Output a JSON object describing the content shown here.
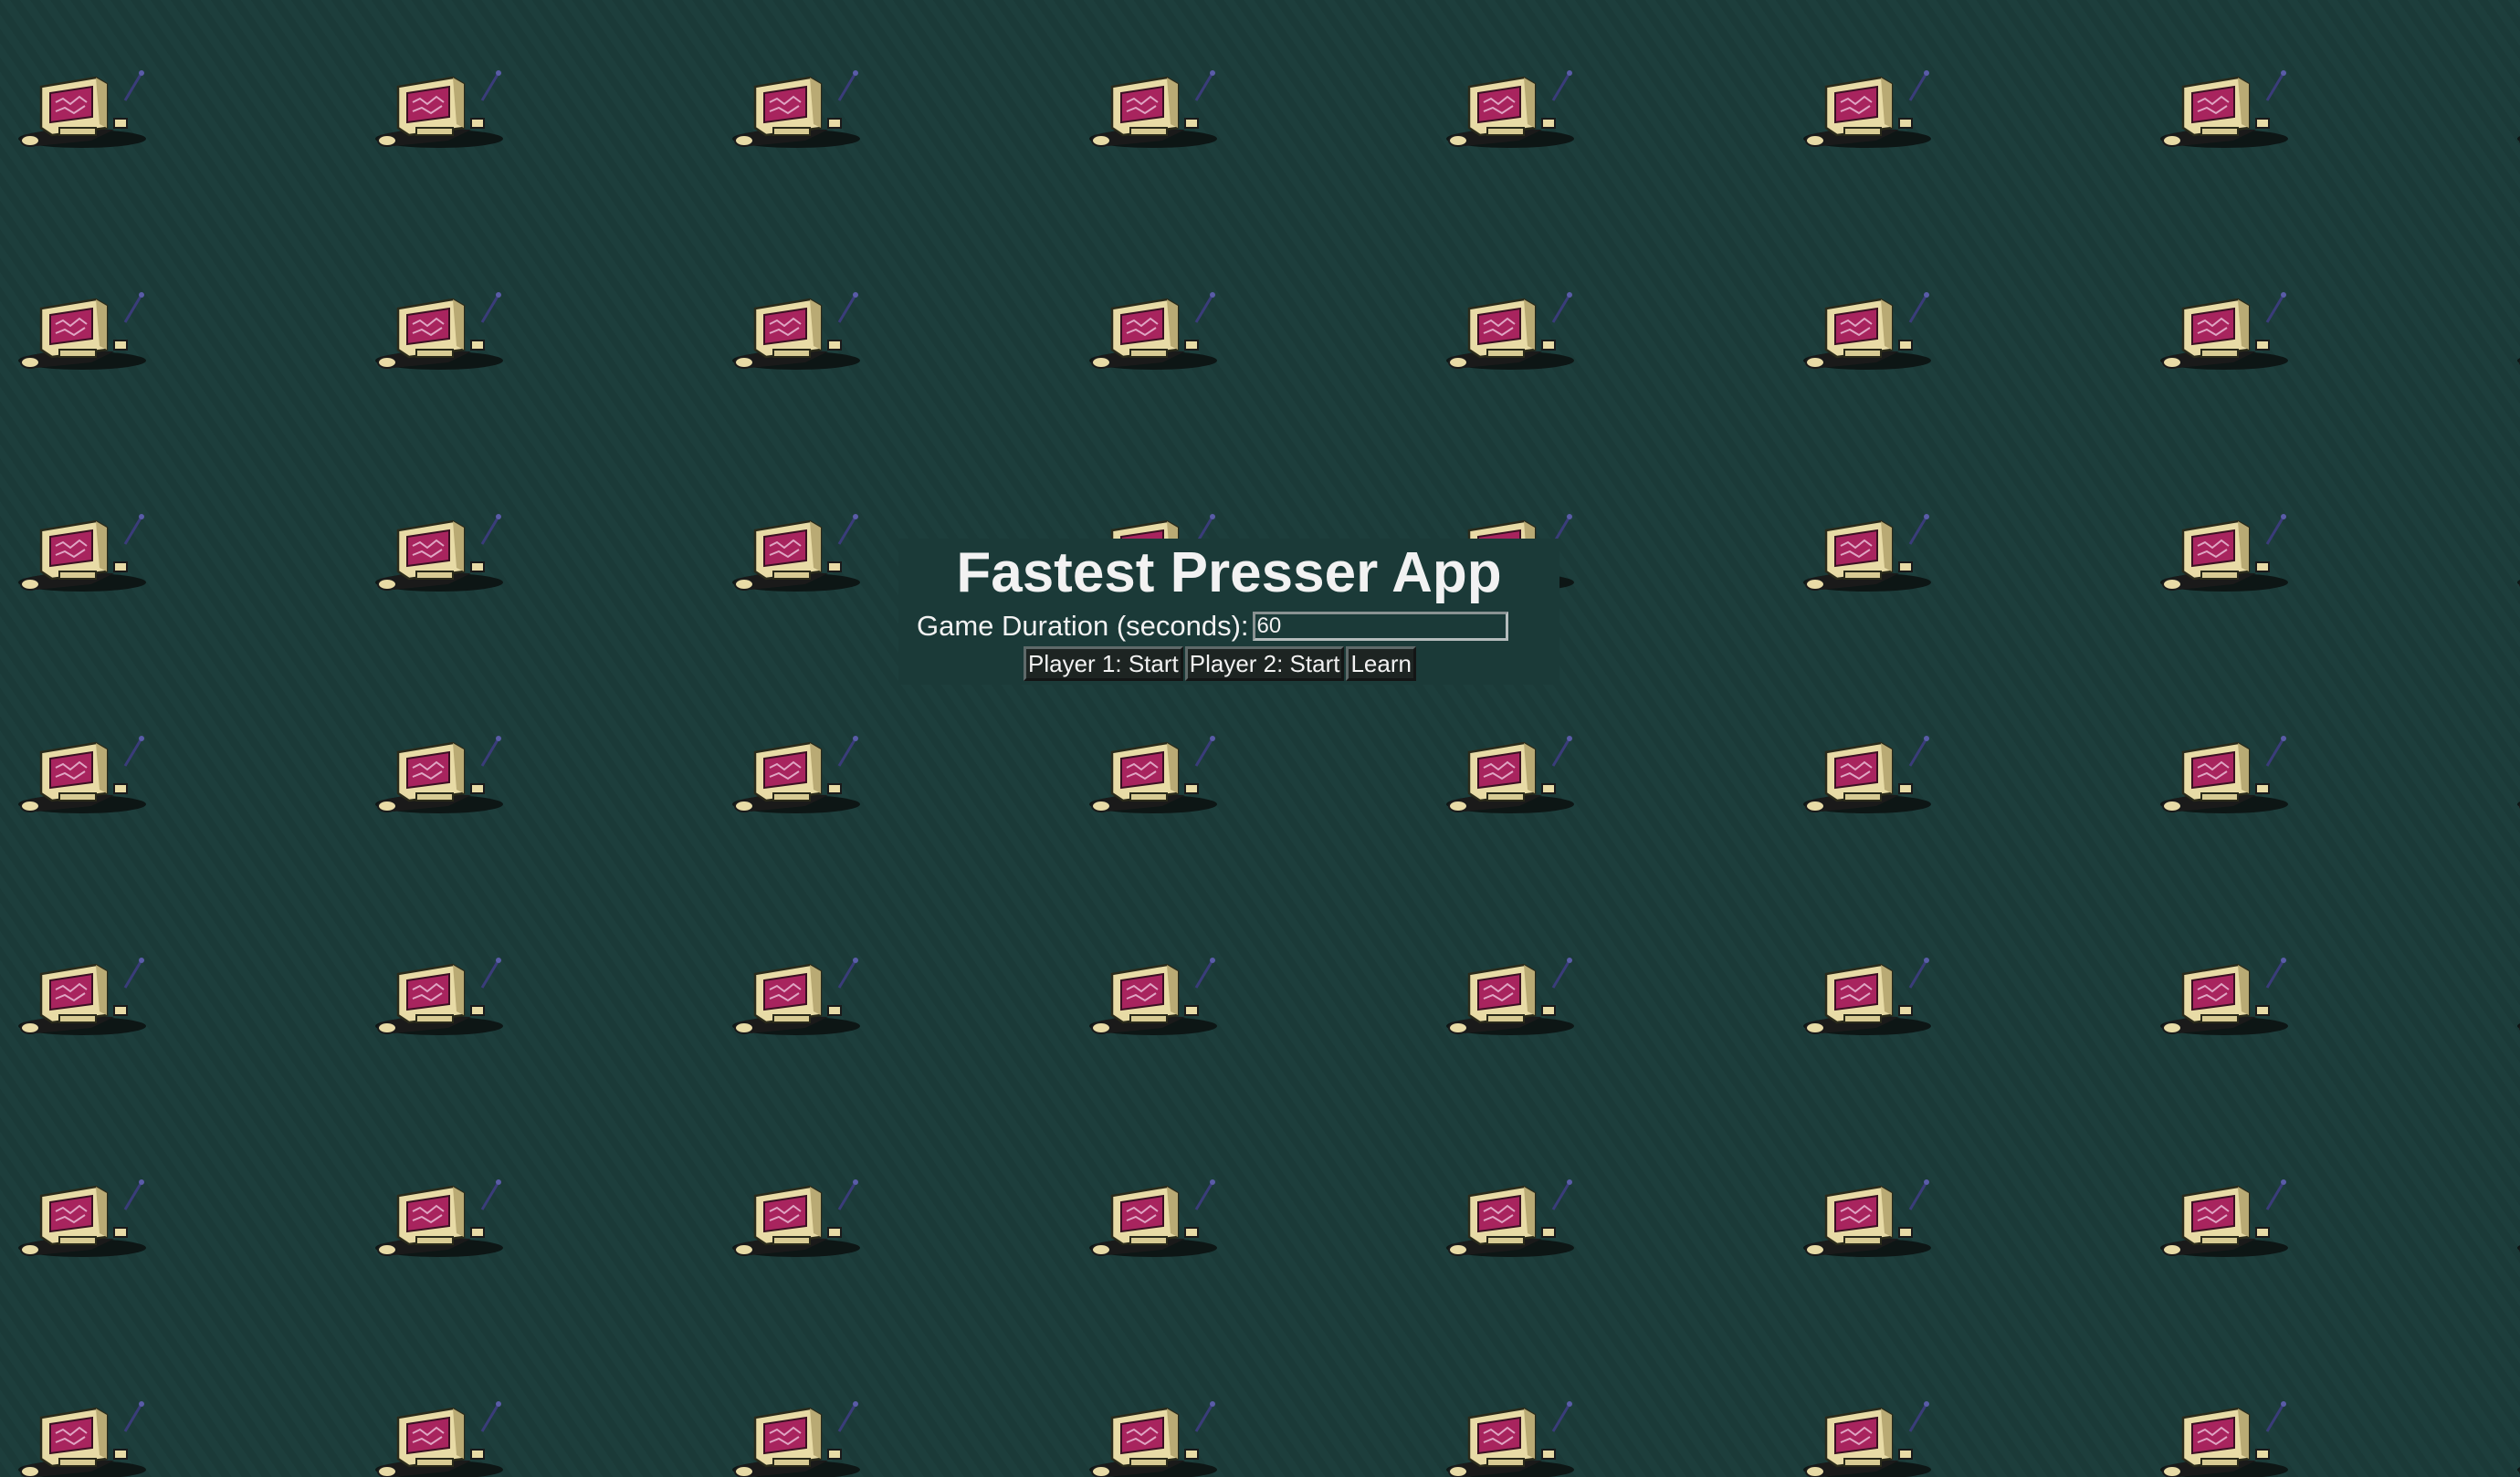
{
  "app": {
    "title": "Fastest Presser App"
  },
  "settings": {
    "duration_label": "Game Duration (seconds):",
    "duration_value": "60"
  },
  "buttons": {
    "player1": "Player 1: Start",
    "player2": "Player 2: Start",
    "learn": "Learn"
  },
  "background": {
    "color": "#1b3a38",
    "tile_icon": "retro-computer-icon"
  }
}
